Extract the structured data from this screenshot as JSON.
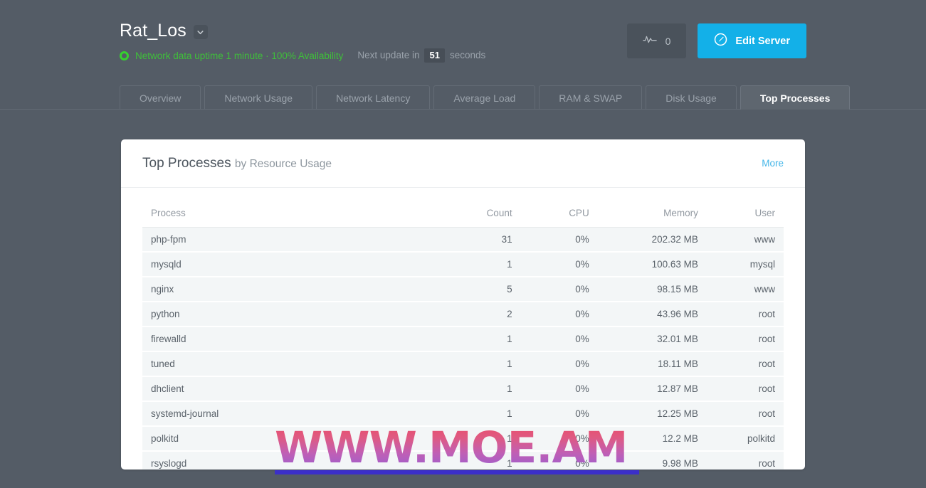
{
  "header": {
    "server_name": "Rat_Los",
    "caret_icon": "chevron-down-icon",
    "status_icon": "green-ring-status-icon",
    "status_text": "Network data uptime 1 minute · 100% Availability",
    "next_update_prefix": "Next update in",
    "next_update_seconds": "51",
    "next_update_suffix": "seconds",
    "pulse_icon": "activity-pulse-icon",
    "pulse_count": "0",
    "edit_icon": "edit-circle-pencil-icon",
    "edit_label": "Edit Server"
  },
  "tabs": [
    {
      "label": "Overview",
      "active": false
    },
    {
      "label": "Network Usage",
      "active": false
    },
    {
      "label": "Network Latency",
      "active": false
    },
    {
      "label": "Average Load",
      "active": false
    },
    {
      "label": "RAM & SWAP",
      "active": false
    },
    {
      "label": "Disk Usage",
      "active": false
    },
    {
      "label": "Top Processes",
      "active": true
    }
  ],
  "card": {
    "title": "Top Processes",
    "subtitle": "by Resource Usage",
    "more_label": "More",
    "columns": [
      "Process",
      "Count",
      "CPU",
      "Memory",
      "User"
    ],
    "rows": [
      {
        "process": "php-fpm",
        "count": "31",
        "cpu": "0%",
        "memory": "202.32 MB",
        "user": "www"
      },
      {
        "process": "mysqld",
        "count": "1",
        "cpu": "0%",
        "memory": "100.63 MB",
        "user": "mysql"
      },
      {
        "process": "nginx",
        "count": "5",
        "cpu": "0%",
        "memory": "98.15 MB",
        "user": "www"
      },
      {
        "process": "python",
        "count": "2",
        "cpu": "0%",
        "memory": "43.96 MB",
        "user": "root"
      },
      {
        "process": "firewalld",
        "count": "1",
        "cpu": "0%",
        "memory": "32.01 MB",
        "user": "root"
      },
      {
        "process": "tuned",
        "count": "1",
        "cpu": "0%",
        "memory": "18.11 MB",
        "user": "root"
      },
      {
        "process": "dhclient",
        "count": "1",
        "cpu": "0%",
        "memory": "12.87 MB",
        "user": "root"
      },
      {
        "process": "systemd-journal",
        "count": "1",
        "cpu": "0%",
        "memory": "12.25 MB",
        "user": "root"
      },
      {
        "process": "polkitd",
        "count": "1",
        "cpu": "0%",
        "memory": "12.2 MB",
        "user": "polkitd"
      },
      {
        "process": "rsyslogd",
        "count": "1",
        "cpu": "0%",
        "memory": "9.98 MB",
        "user": "root"
      }
    ]
  },
  "watermark": {
    "text": "WWW.MOE.AM"
  },
  "colors": {
    "page_background": "#545c66",
    "accent_blue": "#13b0e8",
    "status_green": "#35d22e",
    "link_blue": "#45b6e8",
    "card_background": "#ffffff",
    "row_background": "#f3f6f7"
  }
}
